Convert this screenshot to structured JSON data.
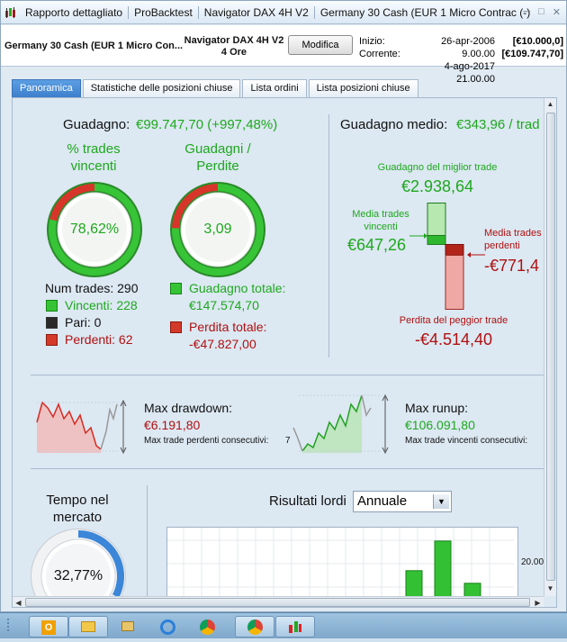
{
  "window": {
    "titles": [
      "Rapporto dettagliato",
      "ProBacktest",
      "Navigator DAX 4H V2",
      "Germany 30 Cash (EUR 1 Micro Contrac (-)"
    ],
    "icons": [
      "minimize-icon",
      "maximize-icon",
      "close-icon"
    ]
  },
  "toolbar": {
    "instrument": "Germany 30 Cash (EUR 1 Micro Con...",
    "strategy_line1": "Navigator DAX 4H V2",
    "strategy_line2": "4 Ore",
    "edit_button": "Modifica",
    "start_label": "Inizio:",
    "current_label": "Corrente:",
    "start_date": "26-apr-2006 9.00.00",
    "current_date": "4-ago-2017 21.00.00",
    "start_capital": "[€10.000,0]",
    "current_capital": "[€109.747,70]"
  },
  "tabs": [
    "Panoramica",
    "Statistiche delle posizioni chiuse",
    "Lista ordini",
    "Lista posizioni chiuse"
  ],
  "summary": {
    "gain_label": "Guadagno:",
    "gain_value": "€99.747,70 (+997,48%)",
    "win_pct_title_1": "% trades",
    "win_pct_title_2": "vincenti",
    "win_pct_value": "78,62%",
    "win_fraction": 0.7862,
    "ratio_title_1": "Guadagni /",
    "ratio_title_2": "Perdite",
    "ratio_value": "3,09",
    "ratio_fraction": 0.7555,
    "num_trades": "Num trades: 290",
    "winners": "Vincenti: 228",
    "even": "Pari: 0",
    "losers": "Perdenti: 62",
    "total_gain_label": "Guadagno totale:",
    "total_gain_value": "€147.574,70",
    "total_loss_label": "Perdita totale:",
    "total_loss_value": "-€47.827,00"
  },
  "average": {
    "title_label": "Guadagno medio:",
    "title_value": "€343,96 / trad",
    "best_label": "Guadagno del miglior trade",
    "best_value": "€2.938,64",
    "avg_win_label_1": "Media trades",
    "avg_win_label_2": "vincenti",
    "avg_win_value": "€647,26",
    "avg_loss_label_1": "Media trades",
    "avg_loss_label_2": "perdenti",
    "avg_loss_value": "-€771,4",
    "worst_label": "Perdita del peggior trade",
    "worst_value": "-€4.514,40"
  },
  "drawdown": {
    "label": "Max drawdown:",
    "value": "€6.191,80",
    "consec_label": "Max trade perdenti consecutivi:",
    "consec_value": "7"
  },
  "runup": {
    "label": "Max runup:",
    "value": "€106.091,80",
    "consec_label": "Max trade vincenti consecutivi:"
  },
  "market": {
    "title_1": "Tempo nel",
    "title_2": "mercato",
    "value": "32,77%",
    "fraction": 0.3277
  },
  "results": {
    "label": "Risultati lordi",
    "period_selected": "Annuale",
    "ytick": "20.00",
    "bars": [
      0.46,
      0.93,
      0.26
    ]
  },
  "taskbar": {
    "apps": [
      "outlook-icon",
      "folder-icon",
      "network-icon",
      "ie-icon",
      "chrome-icon",
      "chrome-icon",
      "prorealtime-icon"
    ]
  },
  "colors": {
    "green": "#1ea81e",
    "red": "#b01010",
    "tab_active": "#3d7fcc"
  }
}
